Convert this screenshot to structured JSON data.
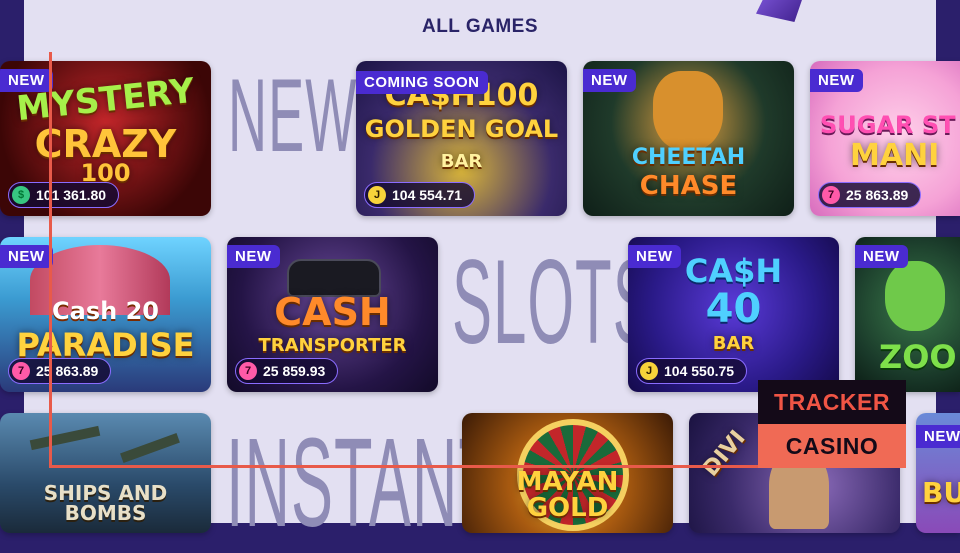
{
  "header": {
    "title": "ALL GAMES"
  },
  "background_words": [
    "NEW",
    "SLOTS",
    "INSTANT"
  ],
  "colors": {
    "badge": "#4a2bd1",
    "panel": "#e3e0f2",
    "accent_line": "#e85a4a"
  },
  "games": [
    {
      "name": "MYSTERY CRAZY 100",
      "badge": "NEW",
      "jackpot": "101 361.80",
      "coin": "green"
    },
    {
      "name": "CA$H100 GOLDEN GOAL",
      "badge": "COMING SOON",
      "jackpot": "104 554.71",
      "coin": "gold"
    },
    {
      "name": "CHEETAH CHASE",
      "badge": "NEW",
      "jackpot": "",
      "coin": ""
    },
    {
      "name": "SUGAR STORM MANIA",
      "badge": "NEW",
      "jackpot": "25 863.89",
      "coin": "pink"
    },
    {
      "name": "Cash 20 PARADISE",
      "badge": "NEW",
      "jackpot": "25 863.89",
      "coin": "pink"
    },
    {
      "name": "CASH TRANSPORTER",
      "badge": "NEW",
      "jackpot": "25 859.93",
      "coin": "pink"
    },
    {
      "name": "CA$H 40",
      "badge": "NEW",
      "jackpot": "104 550.75",
      "coin": "gold"
    },
    {
      "name": "ZOMBIE",
      "badge": "NEW",
      "jackpot": "",
      "coin": ""
    },
    {
      "name": "SHIPS AND BOMBS",
      "badge": "",
      "jackpot": "",
      "coin": ""
    },
    {
      "name": "MAYAN GOLD",
      "badge": "",
      "jackpot": "",
      "coin": ""
    },
    {
      "name": "DIVINE",
      "badge": "",
      "jackpot": "",
      "coin": ""
    },
    {
      "name": "BU",
      "badge": "NEW",
      "jackpot": "",
      "coin": ""
    }
  ],
  "watermark": {
    "line1": "TRACKER",
    "line2": "CASINO"
  },
  "coin_symbols": {
    "gold": "J",
    "pink": "7",
    "green": "$"
  }
}
